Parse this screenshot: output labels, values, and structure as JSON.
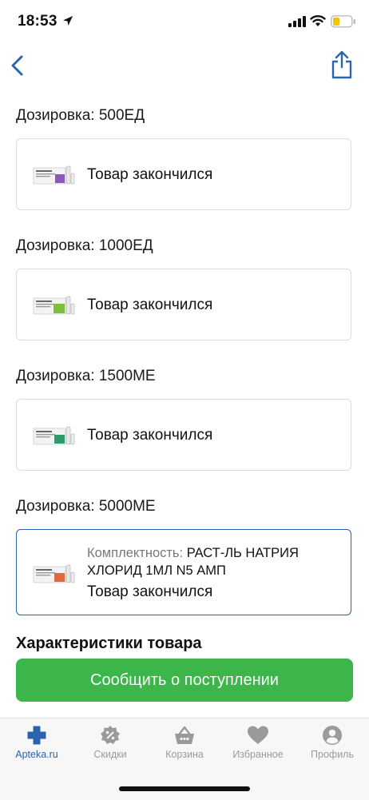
{
  "status_bar": {
    "time": "18:53"
  },
  "variants": [
    {
      "dosage": "Дозировка: 500ЕД",
      "status": "Товар закончился",
      "selected": false,
      "accent": "#8a5bb5"
    },
    {
      "dosage": "Дозировка: 1000ЕД",
      "status": "Товар закончился",
      "selected": false,
      "accent": "#7bbf3a"
    },
    {
      "dosage": "Дозировка: 1500МЕ",
      "status": "Товар закончился",
      "selected": false,
      "accent": "#2f9b6a"
    },
    {
      "dosage": "Дозировка: 5000МЕ",
      "completeness_label": "Комплектность:",
      "completeness_value": "РАСТ-ЛЬ НАТРИЯ ХЛОРИД 1МЛ N5 АМП",
      "status": "Товар закончился",
      "selected": true,
      "accent": "#e06a3a"
    }
  ],
  "section_title": "Характеристики товара",
  "notify_button": "Сообщить о поступлении",
  "tabs": [
    {
      "label": "Apteka.ru",
      "icon": "cross-icon",
      "active": true
    },
    {
      "label": "Скидки",
      "icon": "discount-icon",
      "active": false
    },
    {
      "label": "Корзина",
      "icon": "basket-icon",
      "active": false
    },
    {
      "label": "Избранное",
      "icon": "heart-icon",
      "active": false
    },
    {
      "label": "Профиль",
      "icon": "profile-icon",
      "active": false
    }
  ],
  "colors": {
    "accent": "#2a64b0",
    "button": "#3cb54a",
    "tab_inactive": "#9a9a9a"
  }
}
